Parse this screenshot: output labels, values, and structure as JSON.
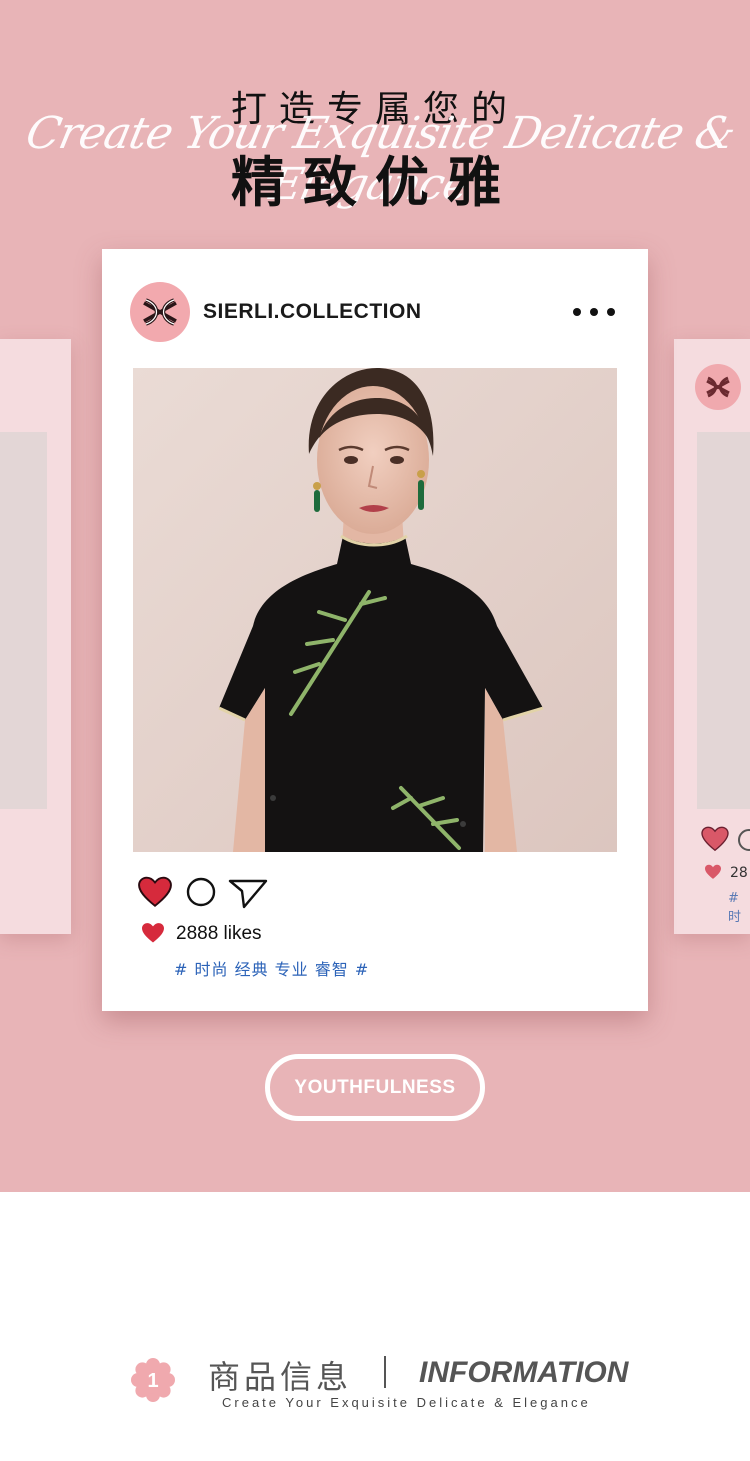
{
  "header": {
    "title_cn_top": "打造专属您的",
    "title_script": "Create Your Exquisite Delicate & Elegance",
    "title_cn_main": "精致优雅"
  },
  "post": {
    "username": "SIERLI.COLLECTION",
    "likes": "2888 likes",
    "tags": "# 时尚 经典 专业 睿智 #"
  },
  "side_card_right": {
    "likes_partial": "28",
    "tag_partial": "# 时"
  },
  "button": {
    "label": "YOUTHFULNESS"
  },
  "info_header": {
    "badge_number": "1",
    "title_cn": "商品信息",
    "separator": "|",
    "title_en": "INFORMATION",
    "subtitle": "Create Your Exquisite Delicate & Elegance"
  },
  "colors": {
    "hero_bg": "#e8b4b7",
    "like_red": "#d62a3c",
    "tag_blue": "#2c63b8",
    "badge_pink": "#f0a9ae"
  },
  "icons": [
    "more-dots-icon",
    "heart-icon",
    "comment-icon",
    "send-icon",
    "brand-logo-icon",
    "flower-badge-icon"
  ]
}
